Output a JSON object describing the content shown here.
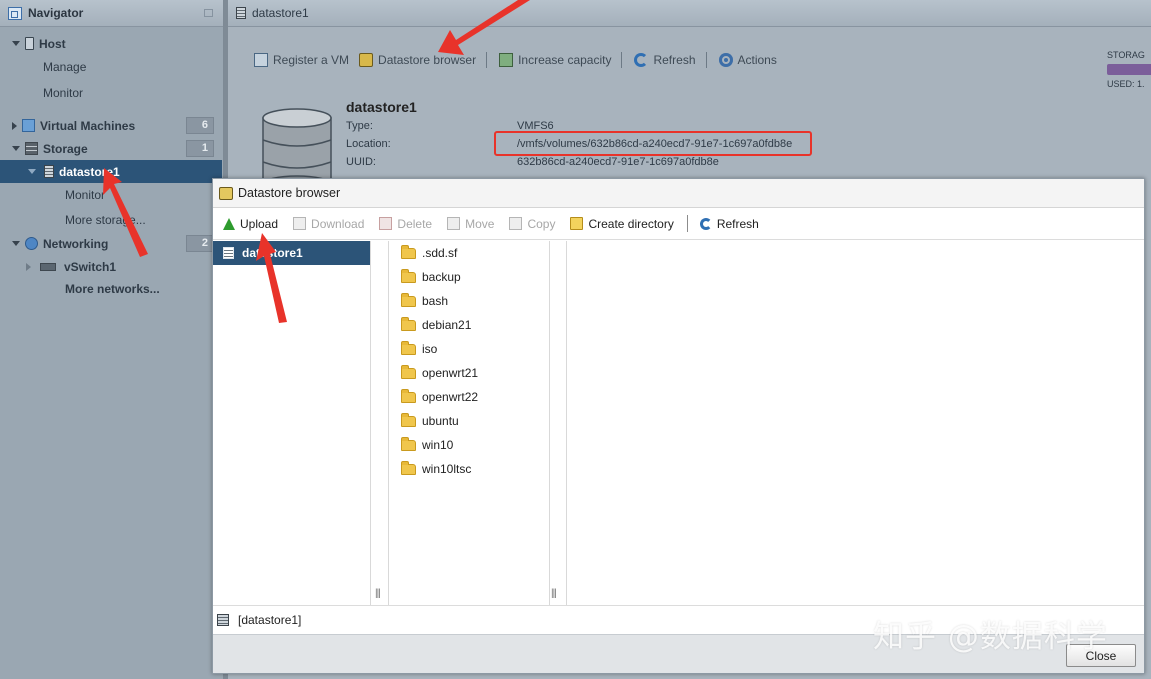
{
  "navigator": {
    "title": "Navigator",
    "items": [
      {
        "label": "Host"
      },
      {
        "label": "Manage"
      },
      {
        "label": "Monitor"
      },
      {
        "label": "Virtual Machines",
        "count": "6"
      },
      {
        "label": "Storage",
        "count": "1"
      },
      {
        "label": "datastore1"
      },
      {
        "label": "Monitor"
      },
      {
        "label": "More storage..."
      },
      {
        "label": "Networking",
        "count": "2"
      },
      {
        "label": "vSwitch1"
      },
      {
        "label": "More networks..."
      }
    ]
  },
  "main": {
    "header": "datastore1",
    "toolbar": {
      "register": "Register a VM",
      "browser": "Datastore browser",
      "increase": "Increase capacity",
      "refresh": "Refresh",
      "actions": "Actions"
    },
    "storage_label": "STORAG",
    "used_label": "USED: 1.",
    "datastore": {
      "name": "datastore1",
      "type_label": "Type:",
      "type_value": "VMFS6",
      "location_label": "Location:",
      "location_value": "/vmfs/volumes/632b86cd-a240ecd7-91e7-1c697a0fdb8e",
      "uuid_label": "UUID:",
      "uuid_value": "632b86cd-a240ecd7-91e7-1c697a0fdb8e"
    }
  },
  "dialog": {
    "title": "Datastore browser",
    "toolbar": {
      "upload": "Upload",
      "download": "Download",
      "delete": "Delete",
      "move": "Move",
      "copy": "Copy",
      "create_directory": "Create directory",
      "refresh": "Refresh"
    },
    "datastores": [
      "datastore1"
    ],
    "folders": [
      ".sdd.sf",
      "backup",
      "bash",
      "debian21",
      "iso",
      "openwrt21",
      "openwrt22",
      "ubuntu",
      "win10",
      "win10ltsc"
    ],
    "status_path": "[datastore1]",
    "close": "Close"
  },
  "watermark": "知乎 @数据科学",
  "colors": {
    "selection": "#2c5478",
    "annotation_red": "#e8332a"
  }
}
